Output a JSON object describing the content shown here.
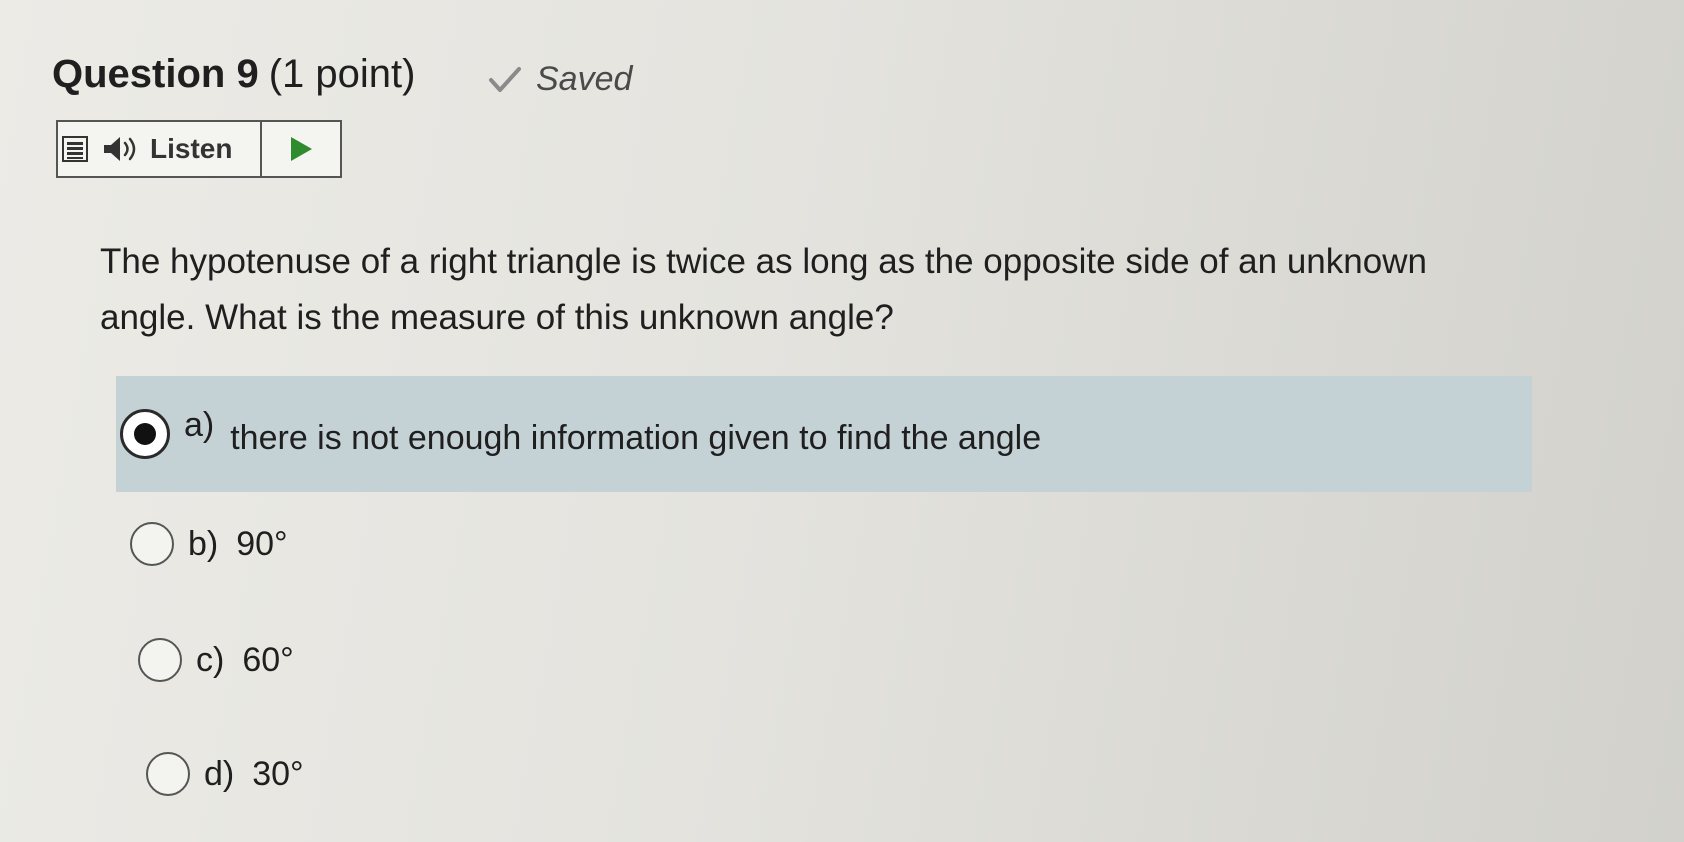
{
  "question": {
    "number_label": "Question 9",
    "points_label": "(1 point)",
    "status": "Saved",
    "status_icon": "check-icon",
    "text": "The hypotenuse of a right triangle is twice as long as the opposite side of an unknown angle.  What is the measure of this unknown angle?"
  },
  "listen_toolbar": {
    "menu_icon": "menu-icon",
    "speaker_icon": "speaker-icon",
    "label": "Listen",
    "play_icon": "play-icon"
  },
  "options": [
    {
      "letter": "a)",
      "text": "there is not enough information given to find the angle",
      "selected": true
    },
    {
      "letter": "b)",
      "text": "90°",
      "selected": false
    },
    {
      "letter": "c)",
      "text": "60°",
      "selected": false
    },
    {
      "letter": "d)",
      "text": "30°",
      "selected": false
    }
  ],
  "colors": {
    "selected_option_bg": "#c5d2d5",
    "play_icon": "#2e8b2e",
    "check_icon": "#8a8a8a"
  }
}
